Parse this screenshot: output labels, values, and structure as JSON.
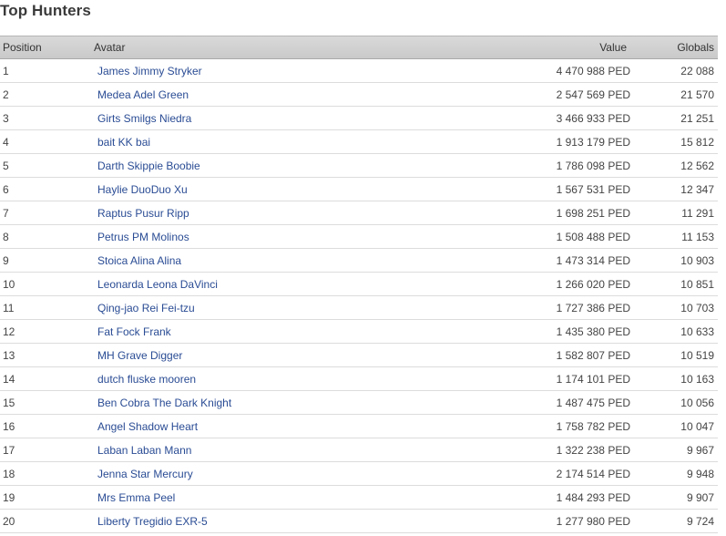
{
  "page": {
    "title": "Top Hunters"
  },
  "table": {
    "headers": {
      "position": "Position",
      "avatar": "Avatar",
      "value": "Value",
      "globals": "Globals"
    },
    "rows": [
      {
        "position": "1",
        "avatar": "James Jimmy Stryker",
        "value": "4 470 988 PED",
        "globals": "22 088"
      },
      {
        "position": "2",
        "avatar": "Medea Adel Green",
        "value": "2 547 569 PED",
        "globals": "21 570"
      },
      {
        "position": "3",
        "avatar": "Girts Smilgs Niedra",
        "value": "3 466 933 PED",
        "globals": "21 251"
      },
      {
        "position": "4",
        "avatar": "bait KK bai",
        "value": "1 913 179 PED",
        "globals": "15 812"
      },
      {
        "position": "5",
        "avatar": "Darth Skippie Boobie",
        "value": "1 786 098 PED",
        "globals": "12 562"
      },
      {
        "position": "6",
        "avatar": "Haylie DuoDuo Xu",
        "value": "1 567 531 PED",
        "globals": "12 347"
      },
      {
        "position": "7",
        "avatar": "Raptus Pusur Ripp",
        "value": "1 698 251 PED",
        "globals": "11 291"
      },
      {
        "position": "8",
        "avatar": "Petrus PM Molinos",
        "value": "1 508 488 PED",
        "globals": "11 153"
      },
      {
        "position": "9",
        "avatar": "Stoica Alina Alina",
        "value": "1 473 314 PED",
        "globals": "10 903"
      },
      {
        "position": "10",
        "avatar": "Leonarda Leona DaVinci",
        "value": "1 266 020 PED",
        "globals": "10 851"
      },
      {
        "position": "11",
        "avatar": "Qing-jao Rei Fei-tzu",
        "value": "1 727 386 PED",
        "globals": "10 703"
      },
      {
        "position": "12",
        "avatar": "Fat Fock Frank",
        "value": "1 435 380 PED",
        "globals": "10 633"
      },
      {
        "position": "13",
        "avatar": "MH Grave Digger",
        "value": "1 582 807 PED",
        "globals": "10 519"
      },
      {
        "position": "14",
        "avatar": "dutch fluske mooren",
        "value": "1 174 101 PED",
        "globals": "10 163"
      },
      {
        "position": "15",
        "avatar": "Ben Cobra The Dark Knight",
        "value": "1 487 475 PED",
        "globals": "10 056"
      },
      {
        "position": "16",
        "avatar": "Angel Shadow Heart",
        "value": "1 758 782 PED",
        "globals": "10 047"
      },
      {
        "position": "17",
        "avatar": "Laban Laban Mann",
        "value": "1 322 238 PED",
        "globals": "9 967"
      },
      {
        "position": "18",
        "avatar": "Jenna Star Mercury",
        "value": "2 174 514 PED",
        "globals": "9 948"
      },
      {
        "position": "19",
        "avatar": "Mrs Emma Peel",
        "value": "1 484 293 PED",
        "globals": "9 907"
      },
      {
        "position": "20",
        "avatar": "Liberty Tregidio EXR-5",
        "value": "1 277 980 PED",
        "globals": "9 724"
      }
    ]
  },
  "colors": {
    "link": "#2a4c94",
    "header_bg": "#d0d0d0",
    "text": "#444444",
    "row_border": "#dcdcdc"
  }
}
